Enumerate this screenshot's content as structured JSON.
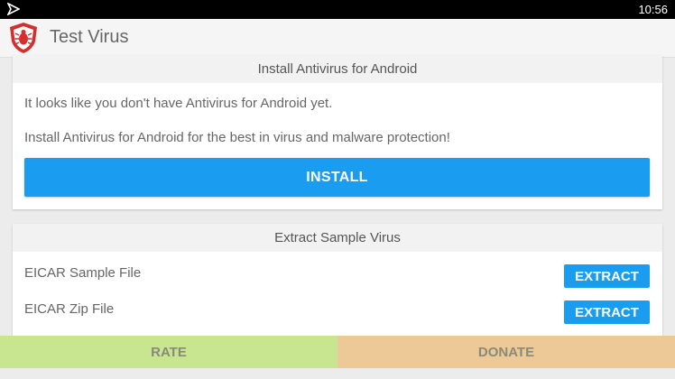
{
  "status_bar": {
    "time": "10:56"
  },
  "app_bar": {
    "title": "Test Virus",
    "logo_icon": "shield-bug-icon",
    "accent_color": "#d32f2f"
  },
  "install_card": {
    "header": "Install Antivirus for Android",
    "line1": "It looks like you don't have Antivirus for Android yet.",
    "line2": "Install Antivirus for Android for the best in virus and malware protection!",
    "install_label": "INSTALL",
    "button_color": "#1a9cf0"
  },
  "extract_card": {
    "header": "Extract Sample Virus",
    "items": [
      {
        "label": "EICAR Sample File",
        "button": "EXTRACT"
      },
      {
        "label": "EICAR Zip File",
        "button": "EXTRACT"
      }
    ]
  },
  "bottom_bar": {
    "rate_label": "RATE",
    "rate_color": "#c8e58f",
    "donate_label": "DONATE",
    "donate_color": "#ecc996"
  }
}
